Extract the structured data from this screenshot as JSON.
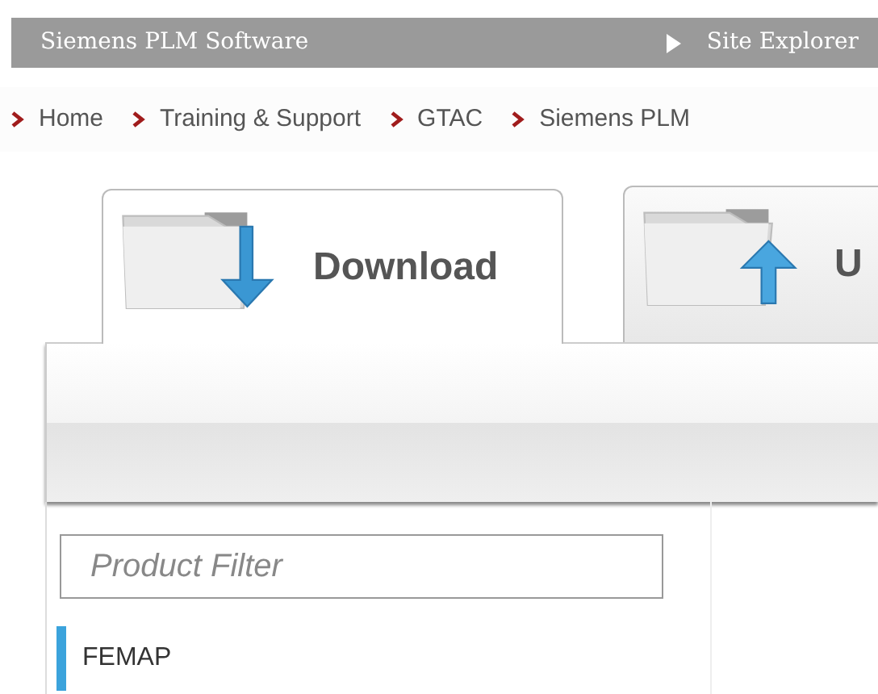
{
  "top_bar": {
    "title": "Siemens PLM Software",
    "link": "Site Explorer"
  },
  "breadcrumb": [
    "Home",
    "Training & Support",
    "GTAC",
    "Siemens PLM"
  ],
  "tabs": [
    {
      "label": "Download",
      "kind": "download",
      "selected": true
    },
    {
      "label": "U",
      "kind": "upload",
      "selected": false
    }
  ],
  "filter": {
    "placeholder": "Product Filter"
  },
  "products": [
    {
      "label": "FEMAP",
      "selected": true
    }
  ]
}
